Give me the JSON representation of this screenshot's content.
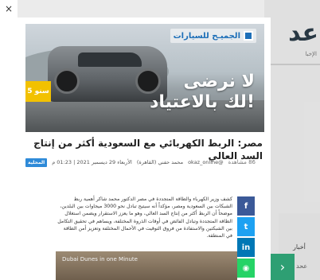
{
  "background": {
    "logo_text": "عد",
    "logo_sub": "الإخبا",
    "side_label_1": "أخبار",
    "side_label_2": "عحد"
  },
  "ad": {
    "brand": "الجميـح للسيارات",
    "headline_line1": "لا نرضى",
    "headline_line2": "لك بالاعتياد!",
    "badge": "5 سنو"
  },
  "article": {
    "title": "مصر: الربط الكهربائي مع السعودية أكثر من إنتاج السد العالي",
    "tag": "المحلية",
    "date": "الأربعاء 29 ديسمبر 2021 | 01:23 م",
    "author": "محمد حفني (القاهرة)",
    "source": "@okaz_online",
    "views": "86 مشاهدة",
    "body": "كشف وزير الكهرباء والطاقة المتجددة في مصر الدكتور محمد شاكر أهمية ربط الشبكات بين السعودية ومصر، مؤكداً أنه سيتيح تبادل نحو 3000 ميجاوات بين البلدين، موضحاً أن الربط أكثر من إنتاج السد العالي، وهو ما يعزز الاستقرار ويضمن استغلال الطاقة المتجددة وتبادل الفائض في أوقات الذروة المختلفة، ويساهم في تحقيق التكامل بين الشبكتين والاستفادة من فروق التوقيت في الأحمال المختلفة وتعزيز أمن الطاقة في المنطقة.",
    "video_caption": "Dubai Dunes in one Minute"
  },
  "share": {
    "facebook": "f",
    "twitter": "t",
    "linkedin": "in",
    "whatsapp": "◉"
  },
  "controls": {
    "close": "×",
    "next": "›"
  }
}
